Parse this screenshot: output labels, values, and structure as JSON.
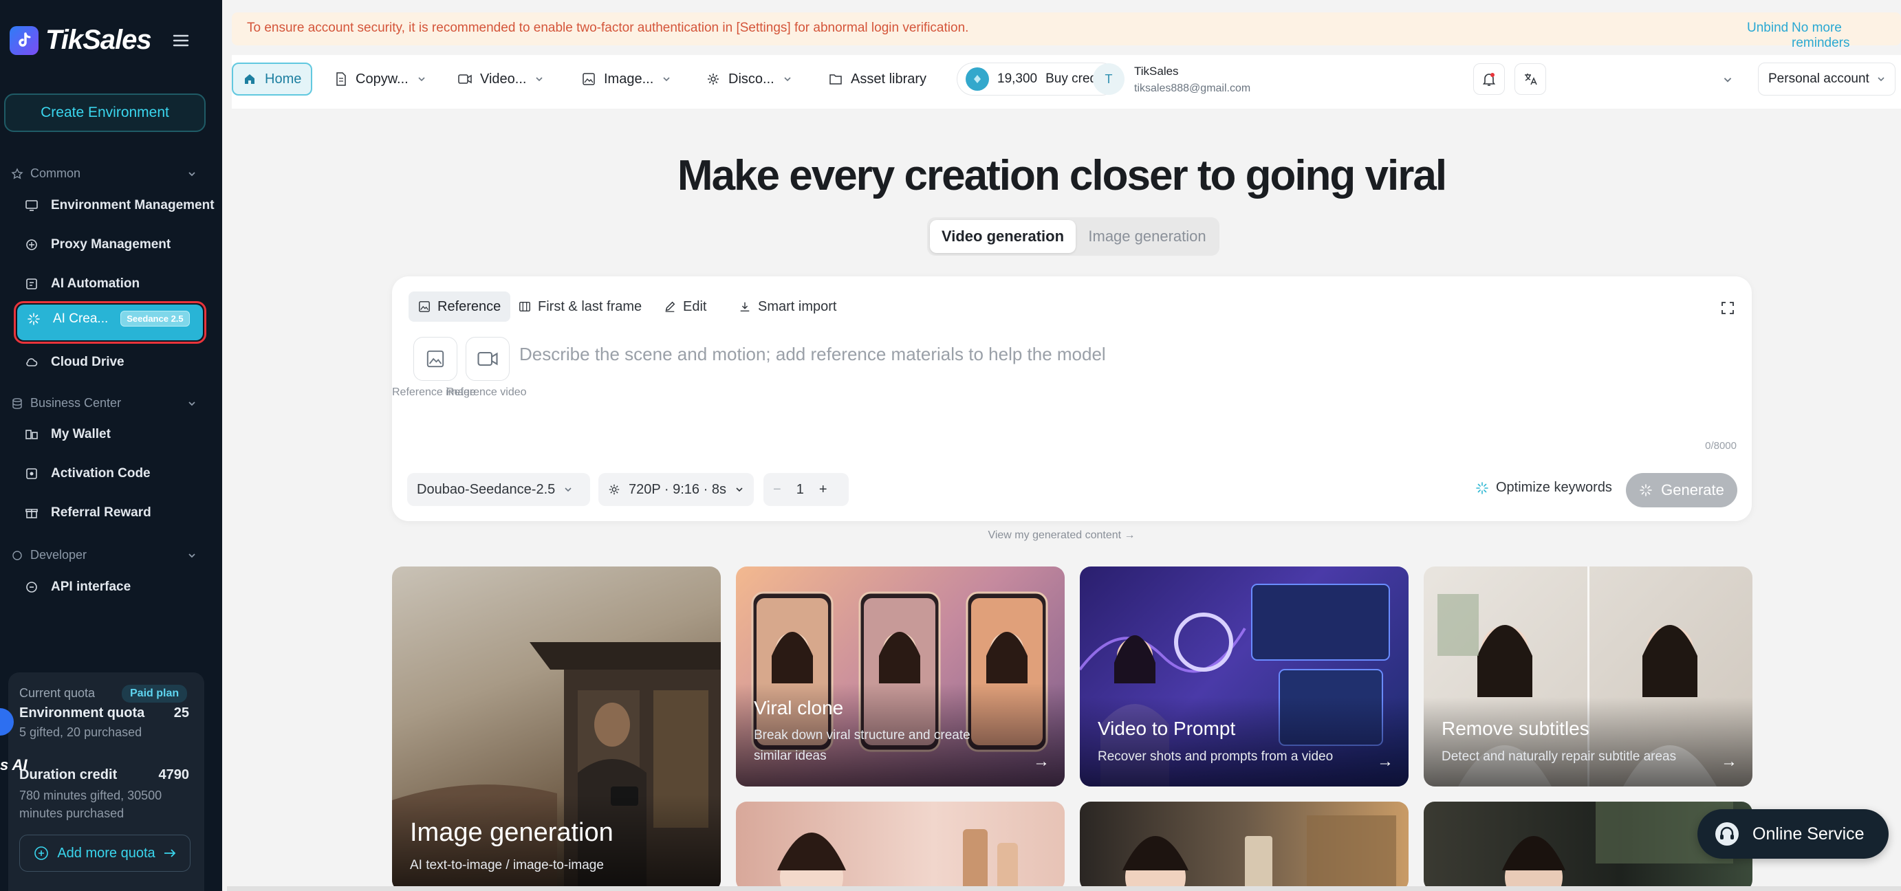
{
  "sidebar": {
    "brand": "TikSales",
    "create_env": "Create Environment",
    "sections": {
      "common": "Common",
      "business": "Business Center",
      "developer": "Developer"
    },
    "items": {
      "env": "Environment Management",
      "proxy": "Proxy Management",
      "automation": "AI Automation",
      "ai_create": "AI Crea...",
      "ai_badge": "Seedance 2.5",
      "cloud": "Cloud Drive",
      "wallet": "My Wallet",
      "activation": "Activation Code",
      "referral": "Referral Reward",
      "api": "API interface"
    },
    "quota": {
      "label": "Current quota",
      "plan": "Paid plan",
      "env_title": "Environment quota",
      "env_value": "25",
      "env_sub": "5 gifted, 20 purchased",
      "dur_title": "Duration credit",
      "dur_value": "4790",
      "dur_sub": "780 minutes gifted, 30500 minutes purchased",
      "add": "Add more quota",
      "fragment": "s AI"
    }
  },
  "notice": {
    "text": "To ensure account security, it is recommended to enable two-factor authentication in [Settings] for abnormal login verification.",
    "unbind": "Unbind",
    "no_more": "No more reminders"
  },
  "topnav": {
    "home": "Home",
    "copy": "Copyw...",
    "video": "Video...",
    "image": "Image...",
    "disco": "Disco...",
    "assets": "Asset library",
    "credits": "19,300",
    "buy": "Buy credits",
    "avatar_letter": "T",
    "user_name": "TikSales",
    "user_email": "tiksales888@gmail.com",
    "account": "Personal account"
  },
  "hero": {
    "title": "Make every creation closer to going viral",
    "seg_video": "Video generation",
    "seg_image": "Image generation"
  },
  "composer": {
    "tabs": [
      "Reference",
      "First & last frame",
      "Edit",
      "Smart import"
    ],
    "ref_image": "Reference image",
    "ref_video": "Reference video",
    "placeholder": "Describe the scene and motion; add reference materials to help the model",
    "counter": "0/8000",
    "model": "Doubao-Seedance-2.5",
    "settings": "720P · 9:16 · 8s",
    "count": "1",
    "minus": "−",
    "plus": "+",
    "optimize": "Optimize keywords",
    "generate": "Generate"
  },
  "view_link": "View my generated content →",
  "tiles": [
    {
      "title": "Image generation",
      "sub": "AI text-to-image / image-to-image"
    },
    {
      "title": "Viral clone",
      "sub": "Break down viral structure and create similar ideas",
      "arrow": "→"
    },
    {
      "title": "Video to Prompt",
      "sub": "Recover shots and prompts from a video",
      "arrow": "→"
    },
    {
      "title": "Remove subtitles",
      "sub": "Detect and naturally repair subtitle areas",
      "arrow": "→"
    }
  ],
  "service": "Online Service",
  "colors": {
    "accent": "#28b4d6",
    "sidebar": "#0d1723",
    "alert": "#d4553a"
  }
}
